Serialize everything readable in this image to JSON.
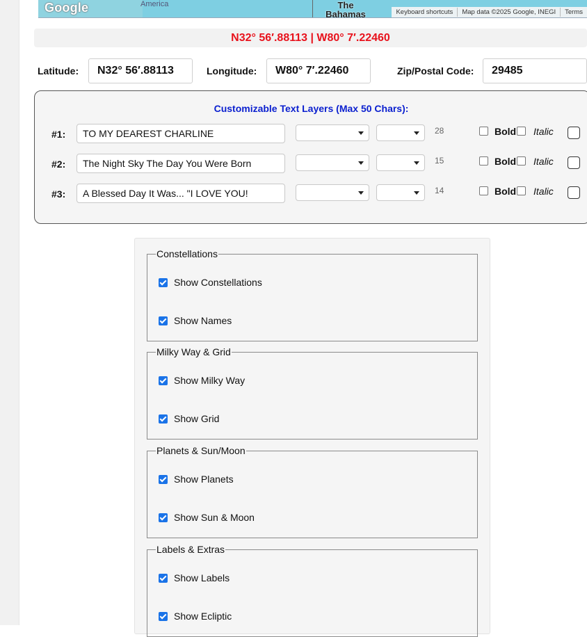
{
  "map": {
    "logo": "Google",
    "place_america": "America",
    "place_bahamas": "The Bahamas",
    "attribution": [
      "Keyboard shortcuts",
      "Map data ©2025 Google, INEGI",
      "Terms"
    ]
  },
  "coords_banner": "N32° 56′.88113 | W80° 7′.22460",
  "latitude": {
    "label": "Latitude:",
    "value": "N32° 56′.88113"
  },
  "longitude": {
    "label": "Longitude:",
    "value": "W80° 7′.22460"
  },
  "zip": {
    "label": "Zip/Postal Code:",
    "value": "29485"
  },
  "text_layers": {
    "title": "Customizable Text Layers (Max 50 Chars):",
    "bold_label": "Bold",
    "italic_label": "Italic",
    "layers": [
      {
        "num": "#1:",
        "text": "TO MY DEAREST CHARLINE",
        "size": "28"
      },
      {
        "num": "#2:",
        "text": "The Night Sky The Day You Were Born",
        "size": "15"
      },
      {
        "num": "#3:",
        "text": "A Blessed Day It Was... \"I LOVE YOU!",
        "size": "14"
      }
    ]
  },
  "options": {
    "groups": [
      {
        "legend": "Constellations",
        "items": [
          "Show Constellations",
          "Show Names"
        ]
      },
      {
        "legend": "Milky Way & Grid",
        "items": [
          "Show Milky Way",
          "Show Grid"
        ]
      },
      {
        "legend": "Planets & Sun/Moon",
        "items": [
          "Show Planets",
          "Show Sun & Moon"
        ]
      },
      {
        "legend": "Labels & Extras",
        "items": [
          "Show Labels",
          "Show Ecliptic"
        ]
      }
    ]
  },
  "colors": {
    "banner_text": "#e8121c",
    "panel_title": "#0a1fcf",
    "checkbox_blue": "#1a73e8"
  }
}
